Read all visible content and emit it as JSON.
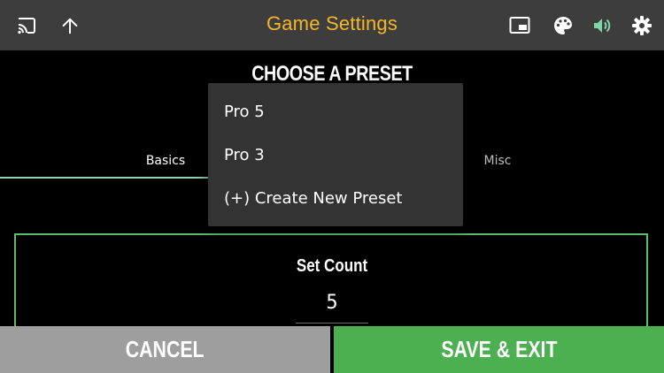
{
  "topbar": {
    "title": "Game Settings",
    "icons": [
      "cast-icon",
      "arrow-up-icon",
      "picture-in-picture-icon",
      "palette-icon",
      "volume-icon",
      "settings-gear-icon"
    ],
    "colors": {
      "background": "#3d3d3d",
      "title": "#f5b62a",
      "icon": "#ffffff",
      "volume_icon": "#7fd6a8"
    }
  },
  "heading": "CHOOSE A PRESET",
  "tabs": [
    {
      "label": "Basics",
      "active": true
    },
    {
      "label": "Misc",
      "active": false
    }
  ],
  "set_count": {
    "label": "Set Count",
    "value": "5"
  },
  "menu": {
    "items": [
      "Pro 5",
      "Pro 3",
      "(+) Create New Preset"
    ]
  },
  "buttons": {
    "cancel": "CANCEL",
    "save": "SAVE & EXIT"
  },
  "colors": {
    "accent_green": "#4caf50",
    "panel_border": "#5bbd6a",
    "tab_underline": "#8fd3b2",
    "cancel_gray": "#9e9e9e"
  }
}
